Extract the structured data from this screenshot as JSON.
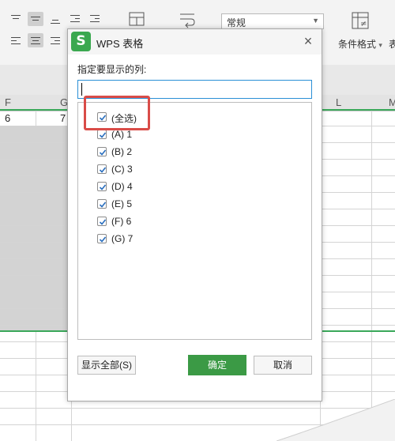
{
  "ribbon": {
    "number_format": "常规",
    "conditional_format": "条件格式",
    "truncated_next": "表"
  },
  "sheet": {
    "columns": [
      "F",
      "G",
      "L",
      "M"
    ],
    "cells": {
      "f1": "6",
      "g1": "7"
    },
    "accent_color": "#3aa85a"
  },
  "dialog": {
    "title": "WPS 表格",
    "logo_letter": "S",
    "close_symbol": "×",
    "prompt": "指定要显示的列:",
    "search_value": "",
    "items": [
      {
        "label": "(全选)",
        "checked": true
      },
      {
        "label": "(A) 1",
        "checked": true
      },
      {
        "label": "(B) 2",
        "checked": true
      },
      {
        "label": "(C) 3",
        "checked": true
      },
      {
        "label": "(D) 4",
        "checked": true
      },
      {
        "label": "(E) 5",
        "checked": true
      },
      {
        "label": "(F) 6",
        "checked": true
      },
      {
        "label": "(G) 7",
        "checked": true
      }
    ],
    "buttons": {
      "show_all": "显示全部(S)",
      "ok": "确定",
      "cancel": "取消"
    },
    "ok_color": "#3b9a45",
    "highlight_color": "#d94c48"
  }
}
